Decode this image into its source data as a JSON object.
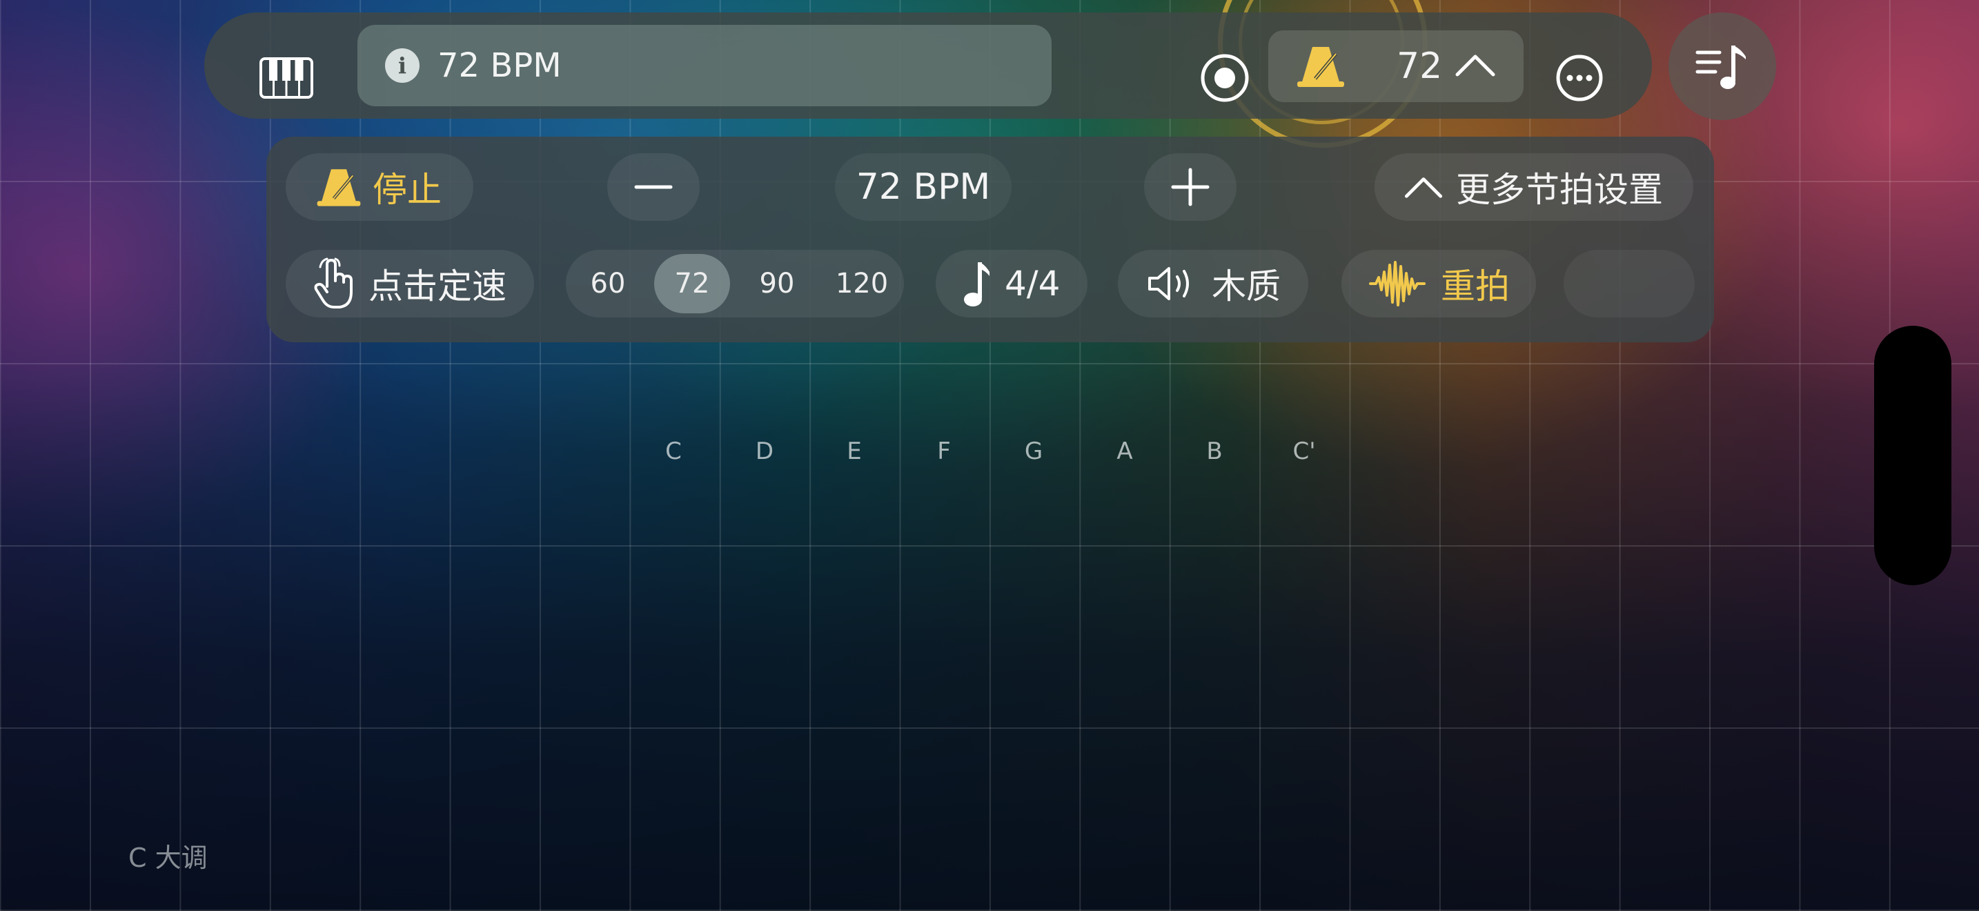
{
  "toolbar": {
    "info_text": "72 BPM",
    "info_icon": "i",
    "metronome_tempo": "72",
    "icons": [
      "piano-icon",
      "info-icon",
      "record-icon",
      "metronome-icon",
      "chevron-up-icon",
      "more-icon",
      "music-list-icon"
    ]
  },
  "panel": {
    "stop_label": "停止",
    "bpm_label": "72 BPM",
    "more_settings_label": "更多节拍设置",
    "tap_tempo_label": "点击定速",
    "presets": [
      "60",
      "72",
      "90",
      "120"
    ],
    "active_preset": "72",
    "time_signature": "4/4",
    "sound_label": "木质",
    "accent_label": "重拍"
  },
  "notes": [
    "C",
    "D",
    "E",
    "F",
    "G",
    "A",
    "B",
    "C'"
  ],
  "key_label": "C 大调",
  "colors": {
    "accent_gold": "#f2c94c",
    "toolbar_bg": "#404846",
    "panel_bg": "#3e4648"
  }
}
